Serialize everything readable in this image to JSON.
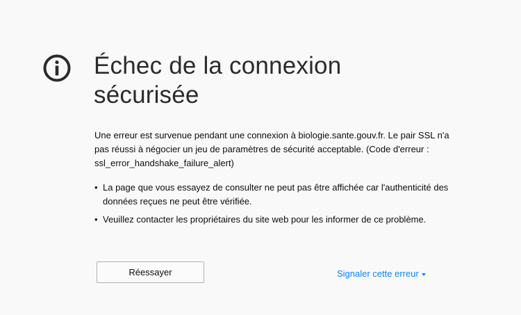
{
  "error": {
    "icon": "info-icon",
    "title_line1": "Échec de la connexion",
    "title_line2": "sécurisée",
    "description": "Une erreur est survenue pendant une connexion à biologie.sante.gouv.fr. Le pair SSL n'a pas réussi à négocier un jeu de paramètres de sécurité acceptable. (Code d'erreur : ssl_error_handshake_failure_alert)",
    "details": [
      "La page que vous essayez de consulter ne peut pas être affichée car l'authenticité des données reçues ne peut être vérifiée.",
      "Veuillez contacter les propriétaires du site web pour les informer de ce problème."
    ],
    "bullet": "•"
  },
  "actions": {
    "retry_label": "Réessayer",
    "report_label": "Signaler cette erreur"
  },
  "colors": {
    "background": "#f9f9fa",
    "icon": "#2b2b2d",
    "link": "#0a84ff"
  }
}
